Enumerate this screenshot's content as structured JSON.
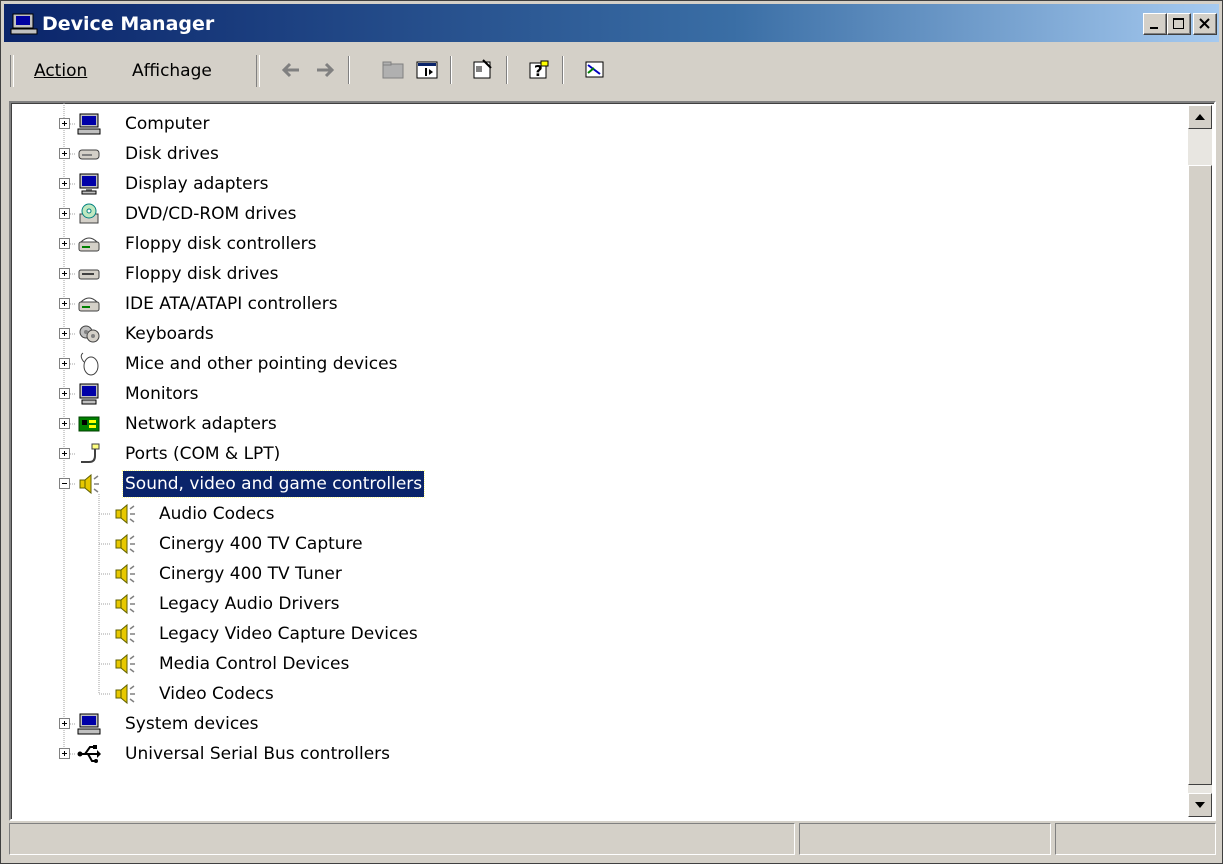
{
  "window": {
    "title": "Device Manager"
  },
  "menu": {
    "items": [
      "Action",
      "Affichage"
    ]
  },
  "toolbar": {
    "icons": [
      "back-arrow-icon",
      "forward-arrow-icon",
      "up-folder-icon",
      "show-hide-tree-icon",
      "properties-icon",
      "help-icon",
      "scan-hardware-icon"
    ]
  },
  "tree": {
    "categories": [
      {
        "label": "Computer",
        "icon": "computer-icon",
        "expanded": false
      },
      {
        "label": "Disk drives",
        "icon": "disk-drive-icon",
        "expanded": false
      },
      {
        "label": "Display adapters",
        "icon": "display-adapter-icon",
        "expanded": false
      },
      {
        "label": "DVD/CD-ROM drives",
        "icon": "cdrom-icon",
        "expanded": false
      },
      {
        "label": "Floppy disk controllers",
        "icon": "controller-icon",
        "expanded": false
      },
      {
        "label": "Floppy disk drives",
        "icon": "floppy-drive-icon",
        "expanded": false
      },
      {
        "label": "IDE ATA/ATAPI controllers",
        "icon": "controller-icon",
        "expanded": false
      },
      {
        "label": "Keyboards",
        "icon": "keyboard-icon",
        "expanded": false
      },
      {
        "label": "Mice and other pointing devices",
        "icon": "mouse-icon",
        "expanded": false
      },
      {
        "label": "Monitors",
        "icon": "monitor-icon",
        "expanded": false
      },
      {
        "label": "Network adapters",
        "icon": "network-adapter-icon",
        "expanded": false
      },
      {
        "label": "Ports (COM & LPT)",
        "icon": "port-icon",
        "expanded": false
      },
      {
        "label": "Sound, video and game controllers",
        "icon": "speaker-icon",
        "expanded": true,
        "selected": true,
        "children": [
          "Audio Codecs",
          "Cinergy 400 TV Capture",
          "Cinergy 400 TV Tuner",
          "Legacy Audio Drivers",
          "Legacy Video Capture Devices",
          "Media Control Devices",
          "Video Codecs"
        ]
      },
      {
        "label": "System devices",
        "icon": "computer-icon",
        "expanded": false
      },
      {
        "label": "Universal Serial Bus controllers",
        "icon": "usb-icon",
        "expanded": false
      }
    ]
  },
  "colors": {
    "title_start": "#0a246a",
    "title_end": "#a6caf0",
    "selection": "#0a246a",
    "face": "#d4d0c8",
    "speaker": "#e8c800"
  }
}
